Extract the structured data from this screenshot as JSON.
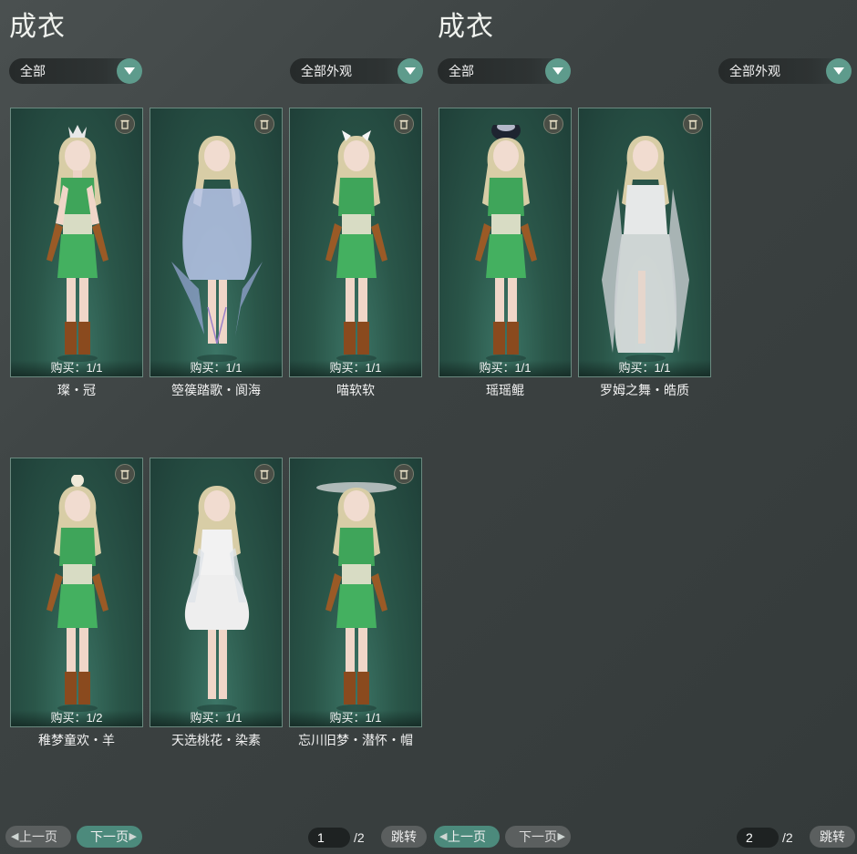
{
  "left": {
    "title": "成衣",
    "filter1": "全部",
    "filter2": "全部外观",
    "cards": [
      {
        "name": "璨・冠",
        "buy": "购买：1/1"
      },
      {
        "name": "箜篌踏歌・阆海",
        "buy": "购买：1/1"
      },
      {
        "name": "喵软软",
        "buy": "购买：1/1"
      },
      {
        "name": "稚梦童欢・羊",
        "buy": "购买：1/2"
      },
      {
        "name": "天选桃花・染素",
        "buy": "购买：1/1"
      },
      {
        "name": "忘川旧梦・潜怀・帽",
        "buy": "购买：1/1"
      }
    ],
    "pagination": {
      "prev": "上一页",
      "next": "下一页",
      "page": "1",
      "total": "/2",
      "jump": "跳转"
    }
  },
  "right": {
    "title": "成衣",
    "filter1": "全部",
    "filter2": "全部外观",
    "cards": [
      {
        "name": "瑶瑶鲲",
        "buy": "购买：1/1"
      },
      {
        "name": "罗姆之舞・皓质",
        "buy": "购买：1/1"
      }
    ],
    "pagination": {
      "prev": "上一页",
      "next": "下一页",
      "page": "2",
      "total": "/2",
      "jump": "跳转"
    }
  },
  "colors": {
    "accent": "#5e9b8c",
    "card_bg": "#2a5649",
    "button_active": "#4c8a7c"
  },
  "icons": {
    "dropdown": "chevron-down-icon",
    "delete": "trash-icon"
  }
}
